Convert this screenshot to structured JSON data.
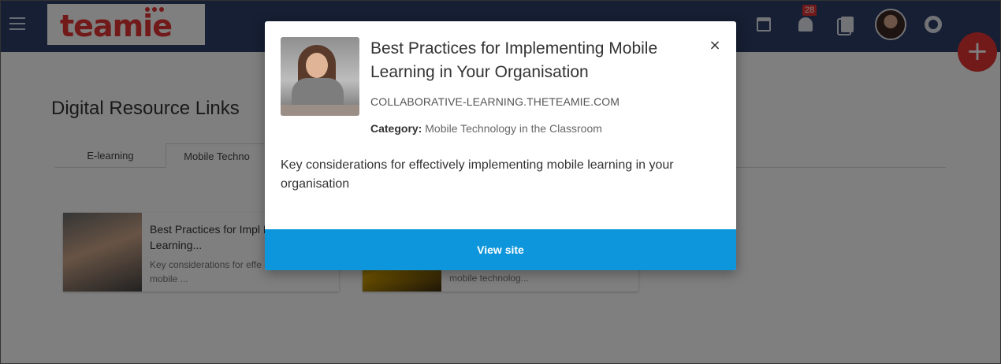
{
  "app": {
    "logo_text": "teamie",
    "notification_count": "28"
  },
  "page": {
    "title": "Digital Resource Links",
    "tabs": [
      {
        "label": "E-learning"
      },
      {
        "label": "Mobile Techno"
      }
    ],
    "cards": [
      {
        "title": "Best Practices for Impl Mobile Learning...",
        "description": "Key considerations for effe implementing mobile ..."
      },
      {
        "title": "",
        "description": "mobile technolog..."
      }
    ]
  },
  "modal": {
    "title": "Best Practices for Implementing Mobile Learning in Your Organisation",
    "domain": "COLLABORATIVE-LEARNING.THETEAMIE.COM",
    "category_label": "Category:",
    "category_value": "Mobile Technology in the Classroom",
    "description": "Key considerations for effectively implementing mobile learning in your organisation",
    "view_button": "View site",
    "close_symbol": "×"
  },
  "colors": {
    "topbar": "#2c3e66",
    "brand_red": "#e53535",
    "primary_button": "#0d96db"
  },
  "icons": [
    "menu-icon",
    "calendar-icon",
    "bell-icon",
    "documents-icon",
    "help-icon",
    "plus-icon",
    "close-icon"
  ]
}
